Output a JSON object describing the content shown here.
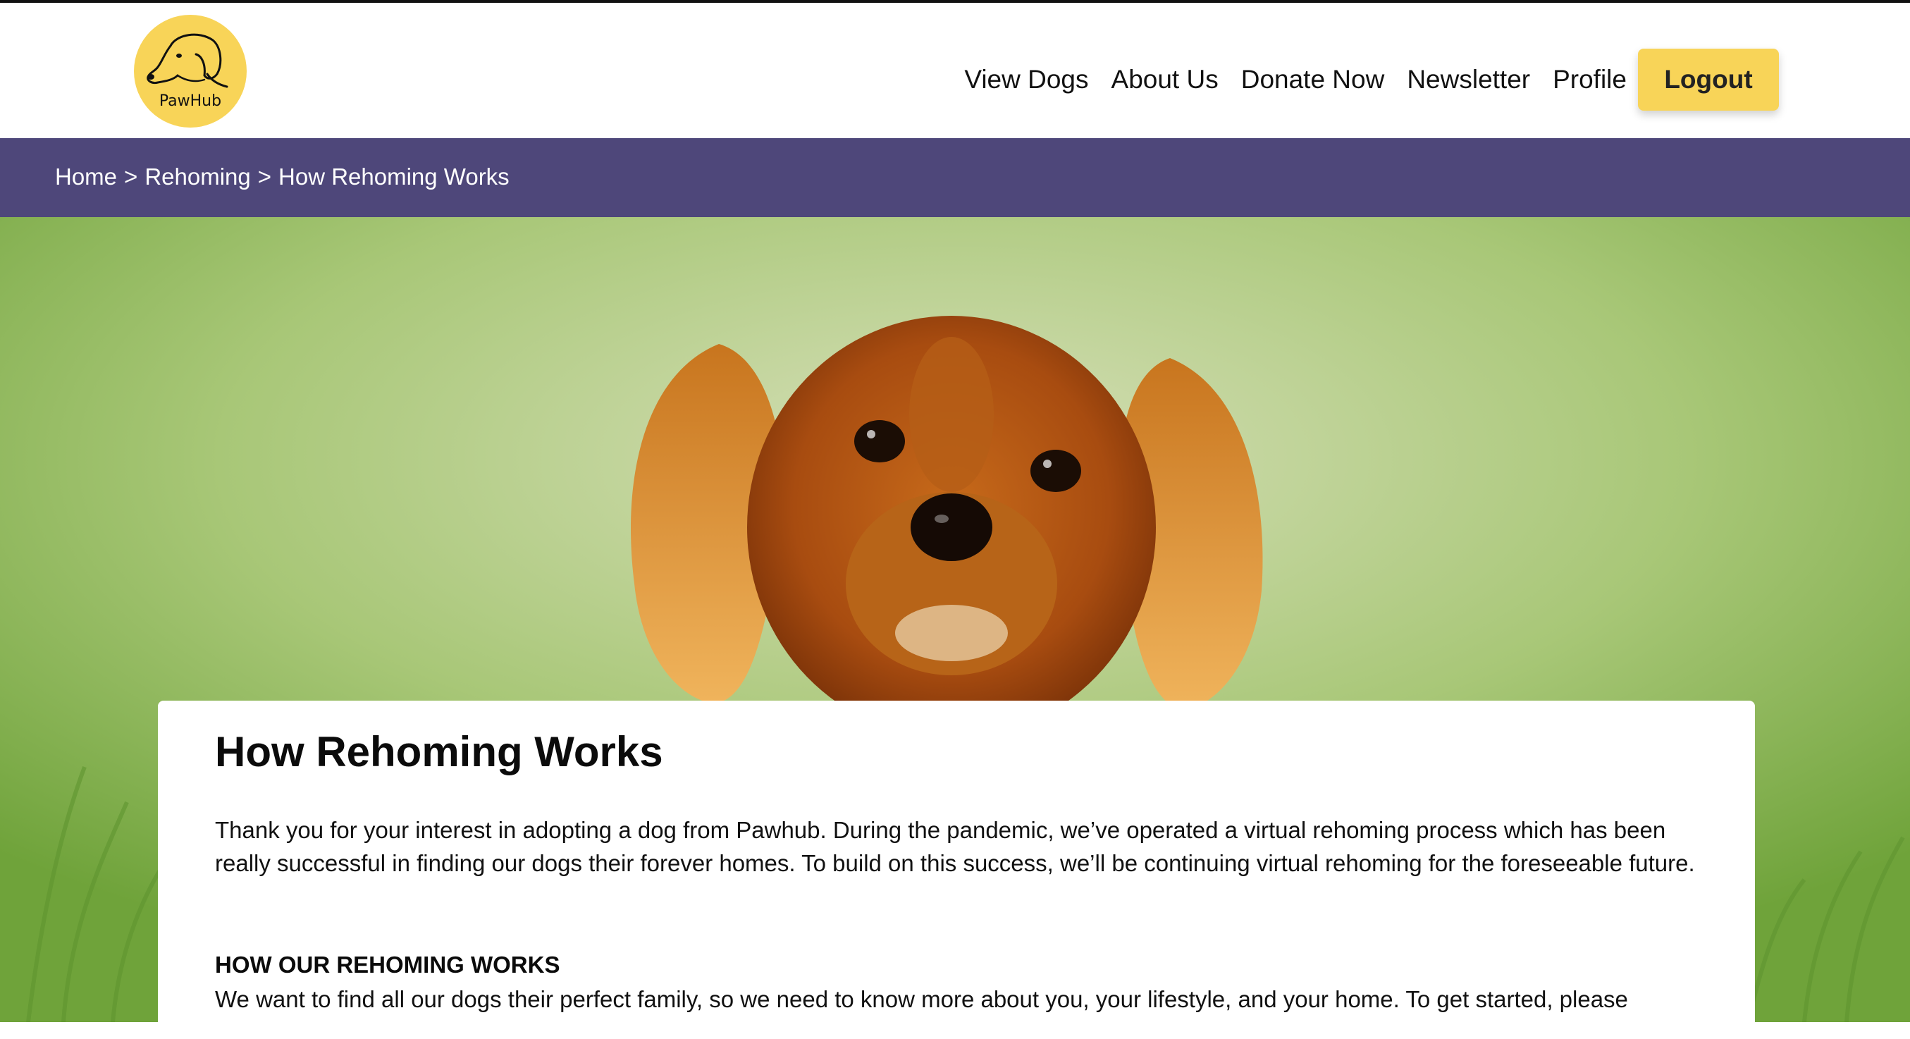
{
  "brand": {
    "name": "PawHub",
    "logo_icon": "dog-head-icon",
    "accent": "#f8d458",
    "nav_purple": "#4e477a"
  },
  "nav": {
    "items": [
      {
        "label": "View Dogs"
      },
      {
        "label": "About Us"
      },
      {
        "label": "Donate Now"
      },
      {
        "label": "Newsletter"
      },
      {
        "label": "Profile"
      }
    ],
    "logout_label": "Logout"
  },
  "breadcrumb": {
    "items": [
      "Home",
      "Rehoming",
      "How Rehoming Works"
    ],
    "separator": ">"
  },
  "hero": {
    "image": "cavalier-king-charles-spaniel-in-grass"
  },
  "content": {
    "title": "How Rehoming Works",
    "intro": "Thank you for your interest in adopting a dog from Pawhub. During the pandemic, we’ve operated a virtual rehoming process which has been really successful in finding our dogs their forever homes. To build on this success, we’ll be continuing virtual rehoming for the foreseeable future.",
    "section_heading": "HOW OUR REHOMING WORKS",
    "section_text": "We want to find all our dogs their perfect family, so we need to know more about you, your lifestyle, and your home. To get started, please"
  }
}
